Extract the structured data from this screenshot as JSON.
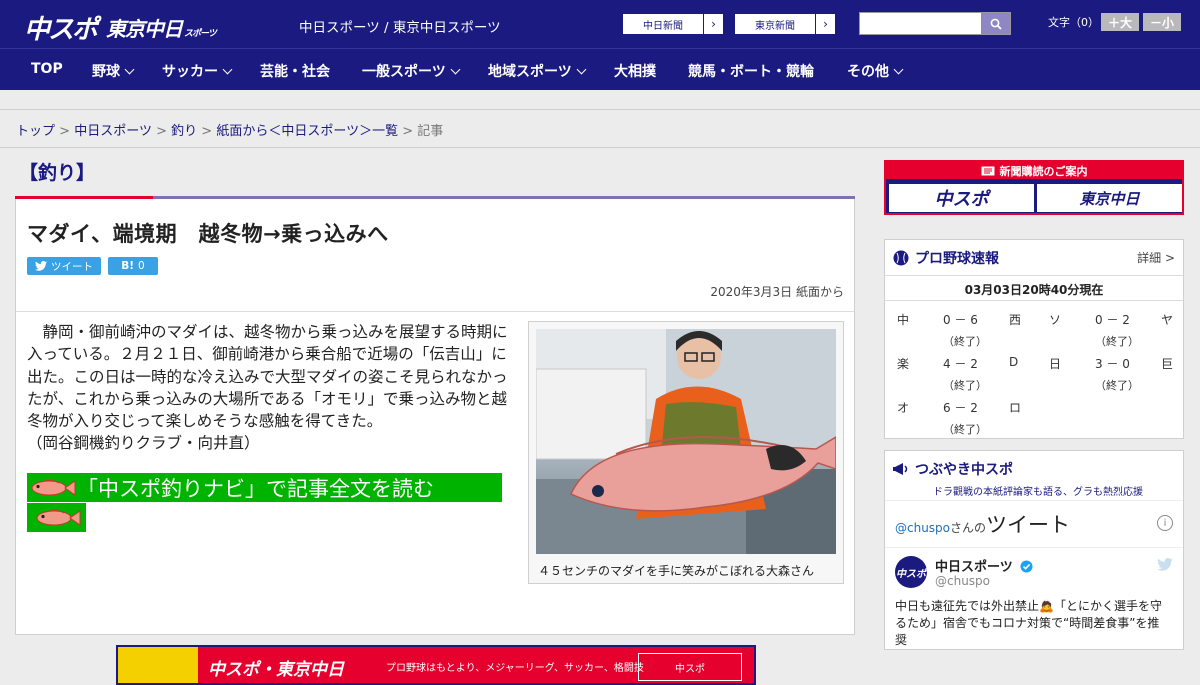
{
  "header": {
    "logo_primary": "中スポ",
    "logo_secondary": "東京中日",
    "logo_secondary_small": "スポーツ",
    "site_name": "中日スポーツ / 東京中日スポーツ",
    "ext_links": [
      "中日新聞",
      "東京新聞"
    ],
    "font_size_label": "文字（0）",
    "font_up": "＋大",
    "font_down": "－小"
  },
  "nav": {
    "items": [
      {
        "label": "TOP"
      },
      {
        "label": "野球"
      },
      {
        "label": "サッカー"
      },
      {
        "label": "芸能・社会"
      },
      {
        "label": "一般スポーツ"
      },
      {
        "label": "地域スポーツ"
      },
      {
        "label": "大相撲"
      },
      {
        "label": "競馬・ボート・競輪"
      },
      {
        "label": "その他"
      }
    ]
  },
  "breadcrumb": {
    "items": [
      "トップ",
      "中日スポーツ",
      "釣り",
      "紙面から＜中日スポーツ＞一覧"
    ],
    "current": "記事",
    "sep": ">"
  },
  "article": {
    "category": "【釣り】",
    "title": "マダイ、端境期　越冬物→乗っ込みへ",
    "tweet_label": "ツイート",
    "hatena_label": "B!",
    "hatena_count": "0",
    "date": "2020年3月3日 紙面から",
    "body": "　静岡・御前崎沖のマダイは、越冬物から乗っ込みを展望する時期に入っている。２月２１日、御前崎港から乗合船で近場の「伝吉山」に出た。この日は一時的な冷え込みで大型マダイの姿こそ見られなかったが、これから乗っ込みの大場所である「オモリ」で乗っ込み物と越冬物が入り交じって楽しめそうな感触を得てきた。",
    "byline": "（岡谷鋼機釣りクラブ・向井直）",
    "navi_link": "「中スポ釣りナビ」で記事全文を読む",
    "photo_caption": "４５センチのマダイを手に笑みがこぼれる大森さん",
    "ad": {
      "logo": "中スポ・東京中日",
      "text": "プロ野球はもとより、メジャーリーグ、サッカー、格闘技",
      "btn": "中スポ"
    }
  },
  "sidebar": {
    "subscribe": {
      "title": "新聞購読のご案内",
      "logo_a": "中スポ",
      "logo_b": "東京中日"
    },
    "scores": {
      "title": "プロ野球速報",
      "detail": "詳細 >",
      "time": "03月03日20時40分現在",
      "games": [
        {
          "t1": "中",
          "score": "0 － 6",
          "t2": "西",
          "status": "（終了）"
        },
        {
          "t1": "ソ",
          "score": "0 － 2",
          "t2": "ヤ",
          "status": "（終了）"
        },
        {
          "t1": "楽",
          "score": "4 － 2",
          "t2": "D",
          "status": "（終了）"
        },
        {
          "t1": "日",
          "score": "3 － 0",
          "t2": "巨",
          "status": "（終了）"
        },
        {
          "t1": "オ",
          "score": "6 － 2",
          "t2": "ロ",
          "status": "（終了）"
        }
      ]
    },
    "twitter": {
      "title": "つぶやき中スポ",
      "subtitle": "ドラ觀戦の本紙評論家も語る、グラも熱烈応援",
      "account_link": "@chuspo",
      "account_suffix": "さんの",
      "heading": "ツイート",
      "name": "中日スポーツ",
      "handle": "@chuspo",
      "text": "中日も遠征先では外出禁止🙇「とにかく選手を守るため」宿舎でもコロナ対策で“時間差食事”を推奨"
    }
  },
  "colors": {
    "brand_navy": "#1a1a80",
    "brand_red": "#e6002d",
    "navi_green": "#00b300",
    "share_blue": "#3aa1e3"
  }
}
